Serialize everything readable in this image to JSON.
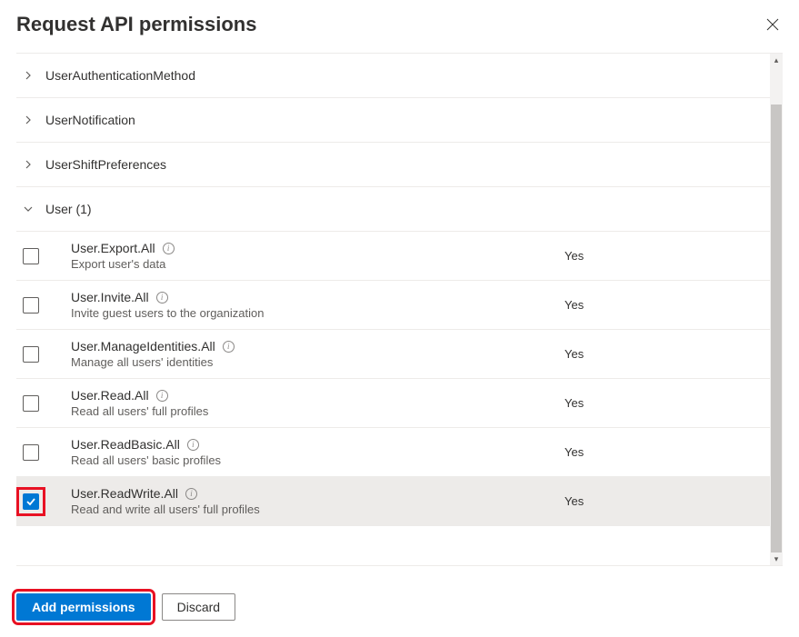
{
  "header": {
    "title": "Request API permissions"
  },
  "groups": [
    {
      "label": "UserAuthenticationMethod",
      "expanded": false
    },
    {
      "label": "UserNotification",
      "expanded": false
    },
    {
      "label": "UserShiftPreferences",
      "expanded": false
    },
    {
      "label": "User (1)",
      "expanded": true
    }
  ],
  "permissions": [
    {
      "name": "User.Export.All",
      "desc": "Export user's data",
      "admin": "Yes",
      "checked": false,
      "highlighted": false
    },
    {
      "name": "User.Invite.All",
      "desc": "Invite guest users to the organization",
      "admin": "Yes",
      "checked": false,
      "highlighted": false
    },
    {
      "name": "User.ManageIdentities.All",
      "desc": "Manage all users' identities",
      "admin": "Yes",
      "checked": false,
      "highlighted": false
    },
    {
      "name": "User.Read.All",
      "desc": "Read all users' full profiles",
      "admin": "Yes",
      "checked": false,
      "highlighted": false
    },
    {
      "name": "User.ReadBasic.All",
      "desc": "Read all users' basic profiles",
      "admin": "Yes",
      "checked": false,
      "highlighted": false
    },
    {
      "name": "User.ReadWrite.All",
      "desc": "Read and write all users' full profiles",
      "admin": "Yes",
      "checked": true,
      "highlighted": true
    }
  ],
  "footer": {
    "primary": "Add permissions",
    "secondary": "Discard"
  }
}
